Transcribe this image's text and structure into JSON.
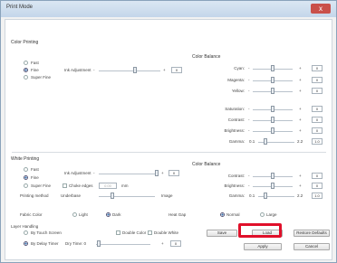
{
  "window": {
    "title": "Print Mode",
    "close_glyph": "x"
  },
  "color_printing": {
    "heading": "Color Printing",
    "modes": [
      "Fast",
      "Fine",
      "Super Fine"
    ],
    "selected_mode": "Fine",
    "ink_adjustment_label": "Ink Adjustment",
    "ink_adjustment_value": "0",
    "minus": "-",
    "plus": "+"
  },
  "color_balance_top": {
    "heading": "Color Balance",
    "rows": [
      {
        "label": "Cyan:",
        "value": "0"
      },
      {
        "label": "Magenta:",
        "value": "0"
      },
      {
        "label": "Yellow:",
        "value": "0"
      },
      {
        "label": "Saturation:",
        "value": "0"
      },
      {
        "label": "Contrast:",
        "value": "0"
      },
      {
        "label": "Brightness:",
        "value": "0"
      }
    ],
    "gamma": {
      "label": "Gamma:",
      "min": "0.1",
      "max": "2.2",
      "value": "1.0"
    }
  },
  "white_printing": {
    "heading": "White Printing",
    "modes": [
      "Fast",
      "Fine",
      "Super Fine"
    ],
    "selected_mode": "Fine",
    "ink_adjustment_label": "Ink Adjustment",
    "ink_adjustment_value": "0",
    "choke_edges_label": "Choke edges",
    "choke_value": "0.00",
    "choke_unit": "mm",
    "printing_method_label": "Printing method",
    "underbase_label": "Underbase",
    "image_label": "Image"
  },
  "color_balance_bottom": {
    "heading": "Color Balance",
    "rows": [
      {
        "label": "Contrast:",
        "value": "0"
      },
      {
        "label": "Brightness:",
        "value": "0"
      }
    ],
    "gamma": {
      "label": "Gamma:",
      "min": "0.1",
      "max": "2.2",
      "value": "1.0"
    }
  },
  "fabric": {
    "label": "Fabric Color",
    "options": [
      "Light",
      "Dark"
    ],
    "selected": "Dark",
    "heat_gap_label": "Heat Gap",
    "heat_options": [
      "Normal",
      "Large"
    ],
    "heat_selected": "Normal"
  },
  "layer": {
    "heading": "Layer Handling",
    "by_touch": "By Touch Screen",
    "double_color": "Double Color",
    "double_white": "Double White",
    "by_delay": "By Delay Timer",
    "dry_time_label": "Dry Time: 0",
    "dry_value": "0"
  },
  "buttons": {
    "save": "Save",
    "load": "Load",
    "restore": "Restore Defaults",
    "apply": "Apply",
    "cancel": "Cancel"
  }
}
